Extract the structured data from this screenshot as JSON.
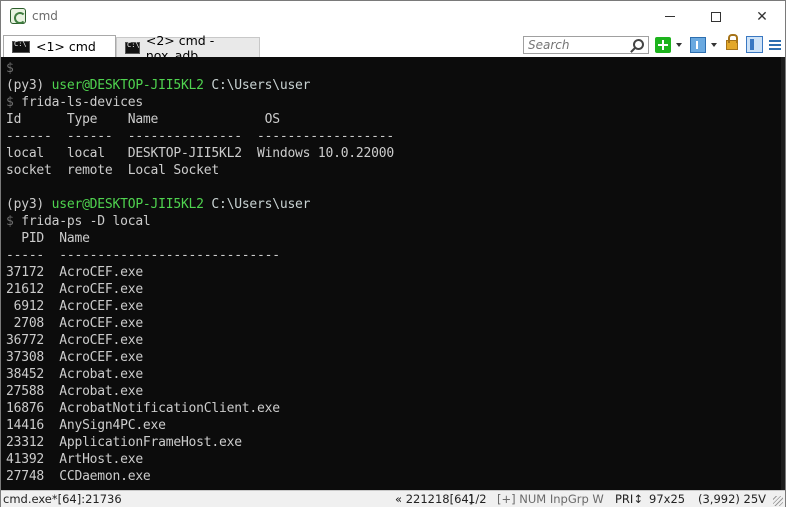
{
  "window": {
    "title": "cmd"
  },
  "tabs": [
    {
      "label": "<1> cmd",
      "active": true
    },
    {
      "label": "<2> cmd - nox_adb  ...",
      "active": false
    }
  ],
  "toolbar": {
    "search_placeholder": "Search",
    "icons": [
      "add-console-icon",
      "panel-icon",
      "lock-icon",
      "split-icon",
      "menu-icon"
    ]
  },
  "terminal": {
    "lines": [
      [
        {
          "t": "$",
          "c": "gray"
        }
      ],
      [
        {
          "t": "(py3) ",
          "c": "default"
        },
        {
          "t": "user@DESKTOP-JII5KL2",
          "c": "green"
        },
        {
          "t": " C:\\Users\\user",
          "c": "cyan"
        }
      ],
      [
        {
          "t": "$ ",
          "c": "gray"
        },
        {
          "t": "frida-ls-devices",
          "c": "default"
        }
      ],
      [
        {
          "t": "Id      Type    Name              OS",
          "c": "default"
        }
      ],
      [
        {
          "t": "------  ------  ---------------  ------------------",
          "c": "default"
        }
      ],
      [
        {
          "t": "local   local   DESKTOP-JII5KL2  Windows 10.0.22000",
          "c": "default"
        }
      ],
      [
        {
          "t": "socket  remote  Local Socket",
          "c": "default"
        }
      ],
      [
        {
          "t": "",
          "c": "default"
        }
      ],
      [
        {
          "t": "(py3) ",
          "c": "default"
        },
        {
          "t": "user@DESKTOP-JII5KL2",
          "c": "green"
        },
        {
          "t": " C:\\Users\\user",
          "c": "cyan"
        }
      ],
      [
        {
          "t": "$ ",
          "c": "gray"
        },
        {
          "t": "frida-ps -D local",
          "c": "default"
        }
      ],
      [
        {
          "t": "  PID  Name",
          "c": "default"
        }
      ],
      [
        {
          "t": "-----  -----------------------------",
          "c": "default"
        }
      ],
      [
        {
          "t": "37172  AcroCEF.exe",
          "c": "default"
        }
      ],
      [
        {
          "t": "21612  AcroCEF.exe",
          "c": "default"
        }
      ],
      [
        {
          "t": " 6912  AcroCEF.exe",
          "c": "default"
        }
      ],
      [
        {
          "t": " 2708  AcroCEF.exe",
          "c": "default"
        }
      ],
      [
        {
          "t": "36772  AcroCEF.exe",
          "c": "default"
        }
      ],
      [
        {
          "t": "37308  AcroCEF.exe",
          "c": "default"
        }
      ],
      [
        {
          "t": "38452  Acrobat.exe",
          "c": "default"
        }
      ],
      [
        {
          "t": "27588  Acrobat.exe",
          "c": "default"
        }
      ],
      [
        {
          "t": "16876  AcrobatNotificationClient.exe",
          "c": "default"
        }
      ],
      [
        {
          "t": "14416  AnySign4PC.exe",
          "c": "default"
        }
      ],
      [
        {
          "t": "23312  ApplicationFrameHost.exe",
          "c": "default"
        }
      ],
      [
        {
          "t": "41392  ArtHost.exe",
          "c": "default"
        }
      ],
      [
        {
          "t": "27748  CCDaemon.exe",
          "c": "default"
        }
      ]
    ]
  },
  "statusbar": {
    "process": "cmd.exe*[64]:21736",
    "position": "« 221218[64]",
    "page": "1/2",
    "flags": "[+] NUM InpGrp W",
    "priority": "PRI↕",
    "size": "97x25",
    "coord": "(3,992) 25V"
  },
  "colors": {
    "terminal_bg": "#0c0c0c",
    "terminal_fg": "#cccccc",
    "prompt_green": "#4fd34f"
  }
}
